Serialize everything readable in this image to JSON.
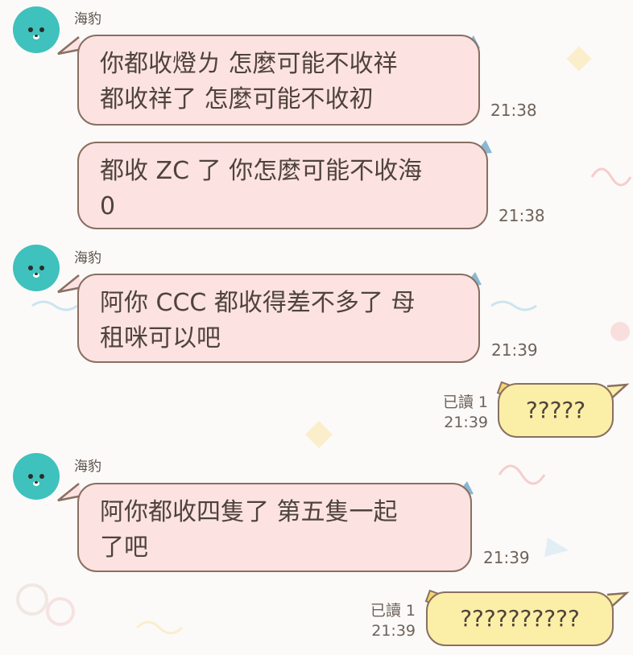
{
  "colors": {
    "avatar": "#3fc1bd",
    "incoming_bubble": "#fce3e2",
    "outgoing_bubble": "#fbeea7",
    "bubble_border": "#8a6f62",
    "tail_in": "#8ab8d3",
    "tail_out": "#f3d66e"
  },
  "messages": [
    {
      "sender": "海豹",
      "text": "你都收燈ㄌ 怎麼可能不收祥\n都收祥了 怎麼可能不收初",
      "time": "21:38"
    },
    {
      "text": "都收 ZC 了 你怎麼可能不收海\n0",
      "time": "21:38"
    },
    {
      "sender": "海豹",
      "text": "阿你 CCC 都收得差不多了 母\n租咪可以吧",
      "time": "21:39"
    },
    {
      "read": "已讀 1",
      "text": "?????",
      "time": "21:39"
    },
    {
      "sender": "海豹",
      "text": "阿你都收四隻了 第五隻一起\n了吧",
      "time": "21:39"
    },
    {
      "read": "已讀 1",
      "text": "??????????",
      "time": "21:39"
    }
  ]
}
